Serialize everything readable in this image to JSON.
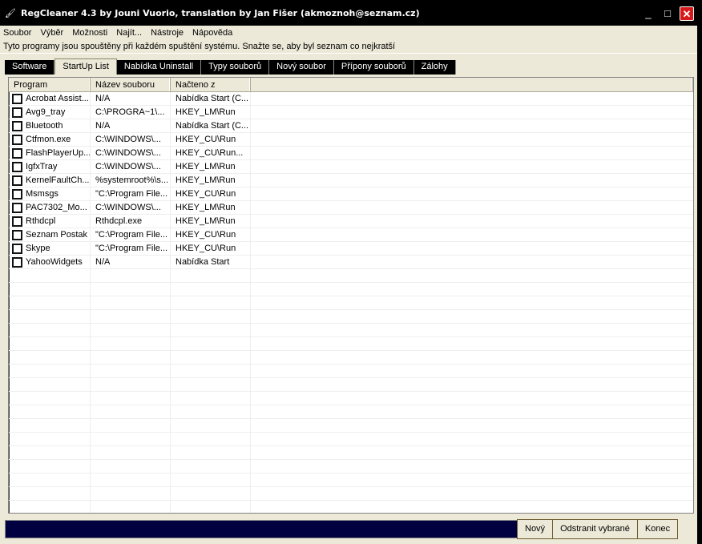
{
  "window": {
    "title": "RegCleaner 4.3 by Jouni Vuorio, translation by Jan Fišer (akmoznoh@seznam.cz)",
    "minimize": "_",
    "maximize": "□",
    "close": "✕"
  },
  "menu": [
    "Soubor",
    "Výběr",
    "Možnosti",
    "Najít...",
    "Nástroje",
    "Nápověda"
  ],
  "description": "Tyto programy jsou spouštěny při každém spuštění systému. Snažte se, aby byl seznam co nejkratší",
  "tabs": [
    "Software",
    "StartUp List",
    "Nabídka Uninstall",
    "Typy souborů",
    "Nový soubor",
    "Přípony souborů",
    "Zálohy"
  ],
  "active_tab": "StartUp List",
  "columns": [
    "Program",
    "Název souboru",
    "Načteno z"
  ],
  "rows": [
    [
      "Acrobat Assist...",
      "N/A",
      "Nabídka Start (C..."
    ],
    [
      "Avg9_tray",
      "C:\\PROGRA~1\\...",
      "HKEY_LM\\Run"
    ],
    [
      "Bluetooth",
      "N/A",
      "Nabídka Start (C..."
    ],
    [
      "Ctfmon.exe",
      "C:\\WINDOWS\\...",
      "HKEY_CU\\Run"
    ],
    [
      "FlashPlayerUp...",
      "C:\\WINDOWS\\...",
      "HKEY_CU\\Run..."
    ],
    [
      "IgfxTray",
      "C:\\WINDOWS\\...",
      "HKEY_LM\\Run"
    ],
    [
      "KernelFaultCh...",
      "%systemroot%\\s...",
      "HKEY_LM\\Run"
    ],
    [
      "Msmsgs",
      "\"C:\\Program File...",
      "HKEY_CU\\Run"
    ],
    [
      "PAC7302_Mo...",
      "C:\\WINDOWS\\...",
      "HKEY_LM\\Run"
    ],
    [
      "Rthdcpl",
      "Rthdcpl.exe",
      "HKEY_LM\\Run"
    ],
    [
      "Seznam Postak",
      "\"C:\\Program File...",
      "HKEY_CU\\Run"
    ],
    [
      "Skype",
      "\"C:\\Program File...",
      "HKEY_CU\\Run"
    ],
    [
      "YahooWidgets",
      "N/A",
      "Nabídka Start"
    ]
  ],
  "buttons": {
    "new": "Nový",
    "remove": "Odstranit vybrané",
    "exit": "Konec"
  },
  "progress": 0
}
